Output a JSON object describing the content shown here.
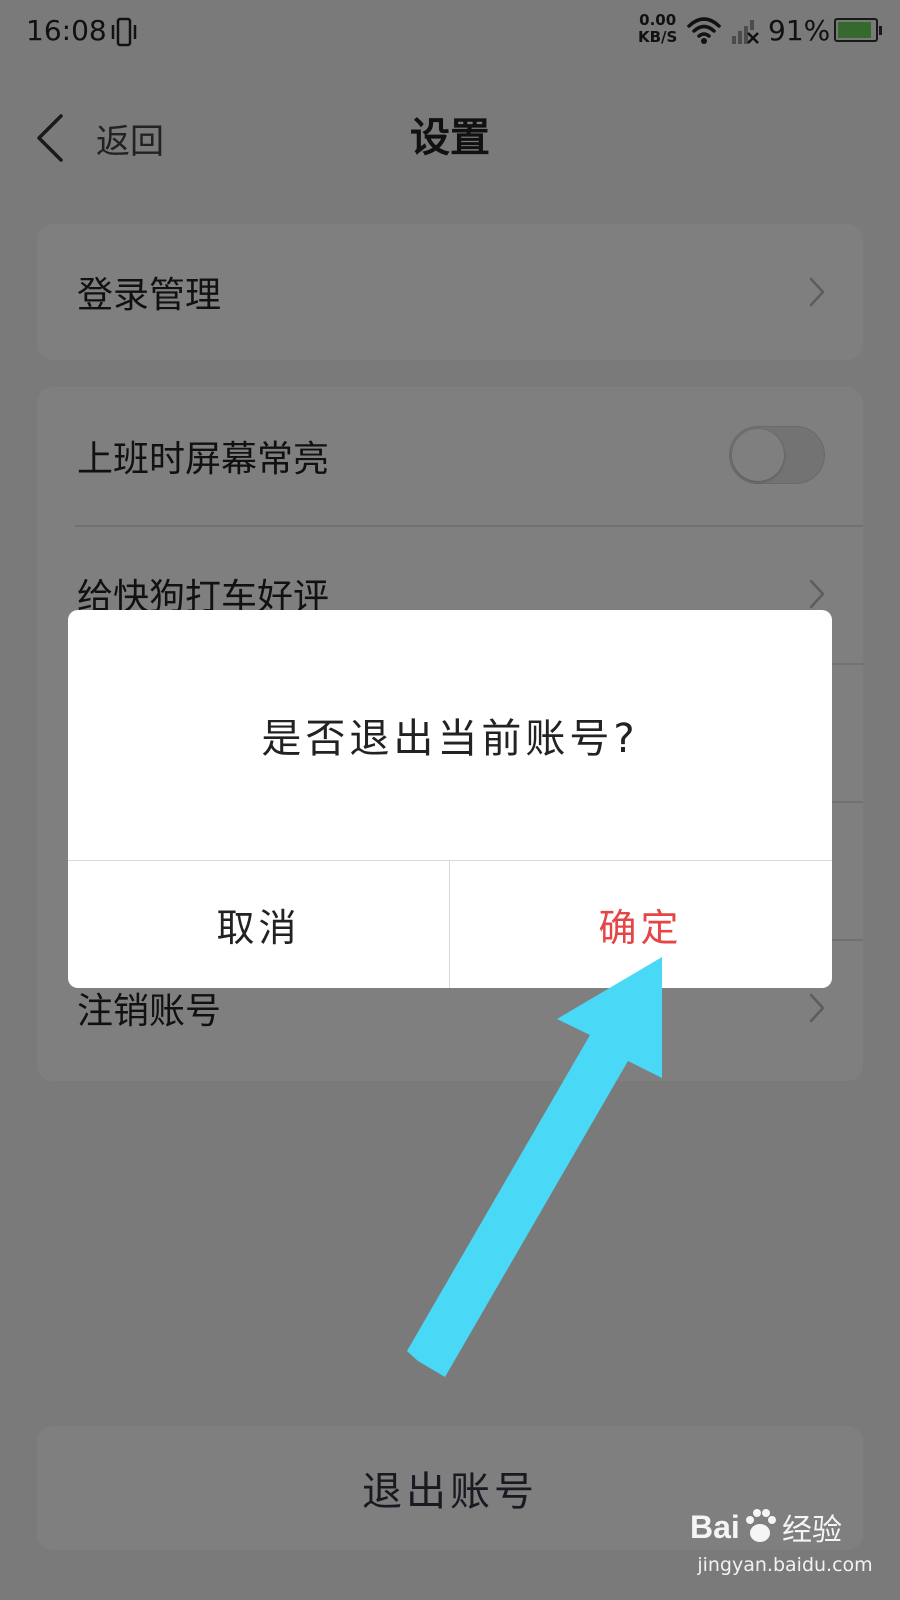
{
  "status_bar": {
    "time": "16:08",
    "net_speed_value": "0.00",
    "net_speed_unit": "KB/S",
    "battery_percent": "91%",
    "battery_level": 0.91,
    "icons": [
      "vibrate-icon",
      "wifi-icon",
      "signal-icon",
      "battery-icon"
    ]
  },
  "nav": {
    "back_label": "返回",
    "title": "设置"
  },
  "settings": {
    "login_management": "登录管理",
    "screen_always_on": "上班时屏幕常亮",
    "screen_always_on_enabled": false,
    "rate_app": "给快狗打车好评",
    "cancel_account": "注销账号"
  },
  "logout_button": "退出账号",
  "dialog": {
    "message": "是否退出当前账号?",
    "cancel": "取消",
    "confirm": "确定",
    "confirm_color": "#e64545"
  },
  "annotation": {
    "arrow_color": "#4ad8f7"
  },
  "watermark": {
    "brand": "Baidu经验",
    "url": "jingyan.baidu.com"
  }
}
